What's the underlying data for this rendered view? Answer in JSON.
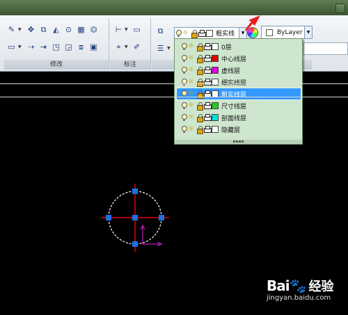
{
  "ribbon": {
    "panels": [
      {
        "label": "修改"
      },
      {
        "label": "标注"
      },
      {
        "label": ""
      }
    ]
  },
  "layer_combo": {
    "current_layer": "粗实线",
    "current_color": "#ffffff"
  },
  "color_control": {
    "value": "ByLayer"
  },
  "layer_list": {
    "selected_index": 4,
    "layers": [
      {
        "name": "0层",
        "color": "#ffffff"
      },
      {
        "name": "中心线层",
        "color": "#e00000"
      },
      {
        "name": "虚线层",
        "color": "#e000e0"
      },
      {
        "name": "细实线层",
        "color": "#ffffff"
      },
      {
        "name": "粗实线层",
        "color": "#ffffff"
      },
      {
        "name": "尺寸线层",
        "color": "#22cc22"
      },
      {
        "name": "剖面线层",
        "color": "#00e0e0"
      },
      {
        "name": "隐藏层",
        "color": "#ffffff"
      }
    ]
  },
  "drawing": {
    "circle_color": "#ffffff",
    "centerline_color": "#e00000",
    "grip_color": "#1e6fe0",
    "ucs_color": "#c020c0"
  },
  "watermark": {
    "logo": "Bai",
    "logo_suffix": "百",
    "brand": "经验",
    "url": "jingyan.baidu.com"
  }
}
